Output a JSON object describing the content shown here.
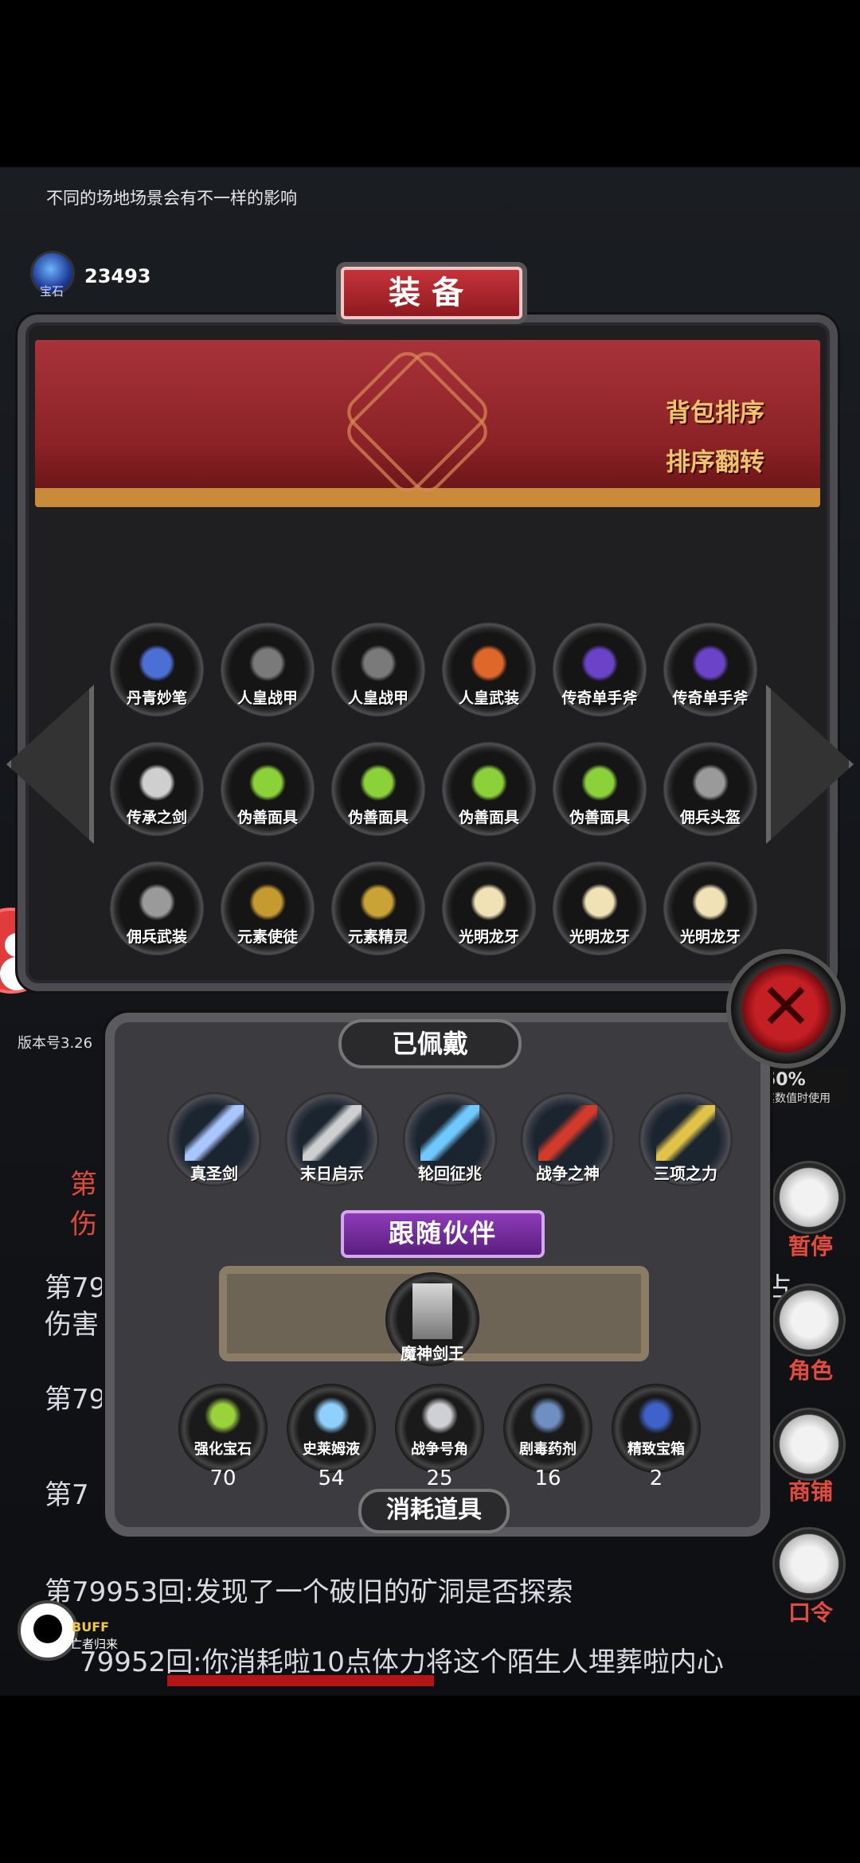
{
  "hud": {
    "hint": "不同的场地场景会有不一样的影响",
    "gem_label": "宝石",
    "gem_count": "23493",
    "version": "版本号3.26"
  },
  "panel": {
    "title": "装备",
    "sort_button": "背包排序",
    "reverse_button": "排序翻转"
  },
  "items": [
    {
      "name": "丹青妙笔",
      "color": "#4c6fd6"
    },
    {
      "name": "人皇战甲",
      "color": "#7a7a7a"
    },
    {
      "name": "人皇战甲",
      "color": "#7a7a7a"
    },
    {
      "name": "人皇武装",
      "color": "#e0672a"
    },
    {
      "name": "传奇单手斧",
      "color": "#6a43c8"
    },
    {
      "name": "传奇单手斧",
      "color": "#6a43c8"
    },
    {
      "name": "传承之剑",
      "color": "#cfcfcf"
    },
    {
      "name": "伪善面具",
      "color": "#8bd13a"
    },
    {
      "name": "伪善面具",
      "color": "#8bd13a"
    },
    {
      "name": "伪善面具",
      "color": "#8bd13a"
    },
    {
      "name": "伪善面具",
      "color": "#8bd13a"
    },
    {
      "name": "佣兵头盔",
      "color": "#9a9a9a"
    },
    {
      "name": "佣兵武装",
      "color": "#9a9a9a"
    },
    {
      "name": "元素使徒",
      "color": "#c59a2e"
    },
    {
      "name": "元素精灵",
      "color": "#c9a335"
    },
    {
      "name": "光明龙牙",
      "color": "#f0e2b5"
    },
    {
      "name": "光明龙牙",
      "color": "#f0e2b5"
    },
    {
      "name": "光明龙牙",
      "color": "#f0e2b5"
    }
  ],
  "equipped": {
    "title": "已佩戴",
    "slots": [
      {
        "name": "真圣剑",
        "color": "#a9c6ff"
      },
      {
        "name": "末日启示",
        "color": "#cfcfcf"
      },
      {
        "name": "轮回征兆",
        "color": "#6fc8ff"
      },
      {
        "name": "战争之神",
        "color": "#d23a2a"
      },
      {
        "name": "三项之力",
        "color": "#e1c34a"
      }
    ]
  },
  "companion": {
    "title": "跟随伙伴",
    "name": "魔神剑王",
    "color": "#d9d9d9"
  },
  "consumables": {
    "title": "消耗道具",
    "items": [
      {
        "name": "强化宝石",
        "count": "70",
        "color": "#9ad23b"
      },
      {
        "name": "史莱姆液",
        "count": "54",
        "color": "#8fd0ff"
      },
      {
        "name": "战争号角",
        "count": "25",
        "color": "#cfcfd6"
      },
      {
        "name": "剧毒药剂",
        "count": "16",
        "color": "#6f8fc2"
      },
      {
        "name": "精致宝箱",
        "count": "2",
        "color": "#3e62c9"
      }
    ]
  },
  "log": {
    "line_a": "第79953回:发现了一个破旧的矿洞是否探索",
    "line_b": "79952回:你消耗啦10点体力将这个陌生人埋葬啦内心",
    "partial_1": "第79",
    "partial_2": "伤害",
    "partial_3": "第79",
    "partial_4": "第7",
    "red_1": "第",
    "red_2": "伤",
    "right_1": "占"
  },
  "side": {
    "stat_value": "50%",
    "stat_sub": "其数值时使用",
    "pause": "暂停",
    "role": "角色",
    "shop": "商铺",
    "code": "口令"
  },
  "buff": {
    "label": "BUFF",
    "sub": "亡者归来"
  }
}
